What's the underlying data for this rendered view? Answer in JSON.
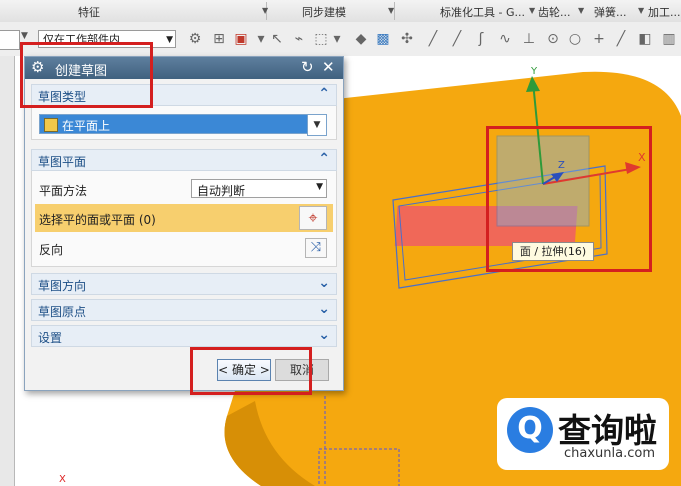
{
  "ribbon": {
    "groups": [
      "特征",
      "同步建模",
      "标准化工具 - G...",
      "齿轮...",
      "弹簧...",
      "加工..."
    ]
  },
  "toolbar": {
    "filter_value": "仅在工作部件内"
  },
  "dialog": {
    "title": "创建草图",
    "sections": {
      "type": {
        "label": "草图类型",
        "selected": "在平面上"
      },
      "plane": {
        "label": "草图平面",
        "method_label": "平面方法",
        "method_value": "自动判断",
        "select_label": "选择平的面或平面 (0)",
        "reverse_label": "反向"
      },
      "orientation": {
        "label": "草图方向"
      },
      "origin": {
        "label": "草图原点"
      },
      "settings": {
        "label": "设置"
      }
    },
    "ok_label": "< 确定 >",
    "cancel_label": "取消"
  },
  "viewport": {
    "tooltip": "面 / 拉伸(16)",
    "axis_x": "X",
    "axis_y": "Y",
    "axis_z": "Z",
    "corner_axis": "X"
  },
  "watermark": {
    "logo": "Q",
    "title": "查询啦",
    "url": "chaxunla.com"
  },
  "colors": {
    "part_body": "#f5a80f",
    "highlight_row": "#f7cf6e",
    "dialog_title": "#4e6f8f",
    "callout_box": "#d41f1f",
    "selected_type": "#3b88d6"
  }
}
